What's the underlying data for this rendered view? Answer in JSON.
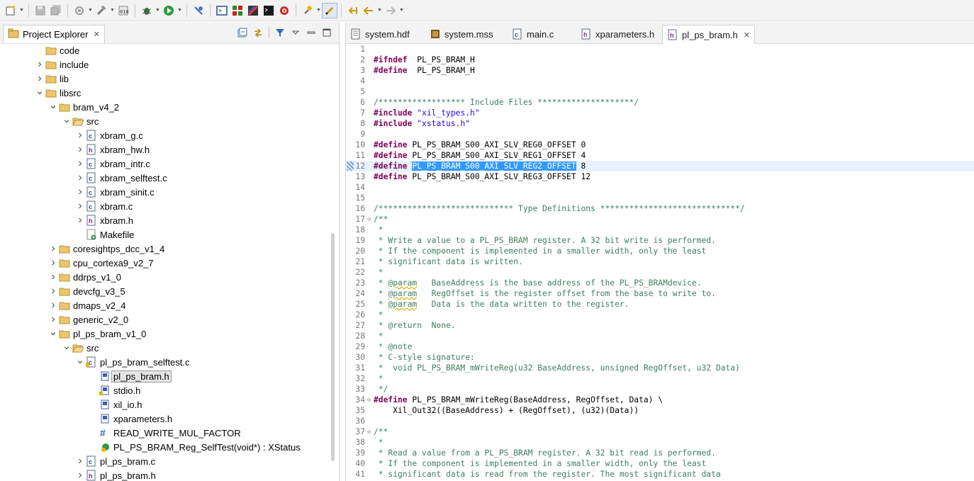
{
  "toolbar": {
    "buttons": [
      "new-icon",
      "save-icon",
      "save-all-icon",
      "preferences-icon",
      "build-icon",
      "program-fpga-icon",
      "debug-icon",
      "run-icon",
      "skip-breakpoints-icon",
      "terminal-icon",
      "xilinx-tools-icon",
      "bitstream-icon",
      "console-icon",
      "target-icon",
      "pin-icon",
      "toggle-mark-occurrences-icon",
      "last-edit-icon",
      "back-icon",
      "forward-icon"
    ]
  },
  "explorer": {
    "title": "Project Explorer",
    "items": [
      {
        "label": "code",
        "depth": 0,
        "arrow": "",
        "icon": "folder"
      },
      {
        "label": "include",
        "depth": 0,
        "arrow": "right",
        "icon": "folder"
      },
      {
        "label": "lib",
        "depth": 0,
        "arrow": "right",
        "icon": "folder"
      },
      {
        "label": "libsrc",
        "depth": 0,
        "arrow": "down",
        "icon": "folder"
      },
      {
        "label": "bram_v4_2",
        "depth": 1,
        "arrow": "down",
        "icon": "folder"
      },
      {
        "label": "src",
        "depth": 2,
        "arrow": "down",
        "icon": "folder-open"
      },
      {
        "label": "xbram_g.c",
        "depth": 3,
        "arrow": "right",
        "icon": "c-file"
      },
      {
        "label": "xbram_hw.h",
        "depth": 3,
        "arrow": "right",
        "icon": "h-file"
      },
      {
        "label": "xbram_intr.c",
        "depth": 3,
        "arrow": "right",
        "icon": "c-file"
      },
      {
        "label": "xbram_selftest.c",
        "depth": 3,
        "arrow": "right",
        "icon": "c-file"
      },
      {
        "label": "xbram_sinit.c",
        "depth": 3,
        "arrow": "right",
        "icon": "c-file"
      },
      {
        "label": "xbram.c",
        "depth": 3,
        "arrow": "right",
        "icon": "c-file"
      },
      {
        "label": "xbram.h",
        "depth": 3,
        "arrow": "right",
        "icon": "h-file"
      },
      {
        "label": "Makefile",
        "depth": 3,
        "arrow": "",
        "icon": "makefile"
      },
      {
        "label": "coresightps_dcc_v1_4",
        "depth": 1,
        "arrow": "right",
        "icon": "folder"
      },
      {
        "label": "cpu_cortexa9_v2_7",
        "depth": 1,
        "arrow": "right",
        "icon": "folder"
      },
      {
        "label": "ddrps_v1_0",
        "depth": 1,
        "arrow": "right",
        "icon": "folder"
      },
      {
        "label": "devcfg_v3_5",
        "depth": 1,
        "arrow": "right",
        "icon": "folder"
      },
      {
        "label": "dmaps_v2_4",
        "depth": 1,
        "arrow": "right",
        "icon": "folder"
      },
      {
        "label": "generic_v2_0",
        "depth": 1,
        "arrow": "right",
        "icon": "folder"
      },
      {
        "label": "pl_ps_bram_v1_0",
        "depth": 1,
        "arrow": "down",
        "icon": "folder"
      },
      {
        "label": "src",
        "depth": 2,
        "arrow": "down",
        "icon": "folder-open"
      },
      {
        "label": "pl_ps_bram_selftest.c",
        "depth": 3,
        "arrow": "down",
        "icon": "c-file-mod"
      },
      {
        "label": "pl_ps_bram.h",
        "depth": 4,
        "arrow": "",
        "icon": "include",
        "selected": true
      },
      {
        "label": "stdio.h",
        "depth": 4,
        "arrow": "",
        "icon": "include-sys"
      },
      {
        "label": "xil_io.h",
        "depth": 4,
        "arrow": "",
        "icon": "include"
      },
      {
        "label": "xparameters.h",
        "depth": 4,
        "arrow": "",
        "icon": "include"
      },
      {
        "label": "READ_WRITE_MUL_FACTOR",
        "depth": 4,
        "arrow": "",
        "icon": "macro"
      },
      {
        "label": "PL_PS_BRAM_Reg_SelfTest(void*) : XStatus",
        "depth": 4,
        "arrow": "",
        "icon": "function"
      },
      {
        "label": "pl_ps_bram.c",
        "depth": 3,
        "arrow": "right",
        "icon": "c-file"
      },
      {
        "label": "pl_ps_bram.h",
        "depth": 3,
        "arrow": "right",
        "icon": "h-file"
      }
    ]
  },
  "editor": {
    "tabs": [
      {
        "label": "system.hdf",
        "icon": "hdf",
        "active": false
      },
      {
        "label": "system.mss",
        "icon": "mss",
        "active": false
      },
      {
        "label": "main.c",
        "icon": "c-file",
        "active": false
      },
      {
        "label": "xparameters.h",
        "icon": "h-file",
        "active": false
      },
      {
        "label": "pl_ps_bram.h",
        "icon": "h-file",
        "active": true
      }
    ],
    "current_line": 12,
    "lines": [
      {
        "n": "1",
        "fold": "",
        "parts": []
      },
      {
        "n": "2",
        "fold": "",
        "parts": [
          [
            "kw",
            "#ifndef"
          ],
          [
            "",
            "  PL_PS_BRAM_H"
          ]
        ]
      },
      {
        "n": "3",
        "fold": "",
        "parts": [
          [
            "kw",
            "#define"
          ],
          [
            "",
            "  PL_PS_BRAM_H"
          ]
        ]
      },
      {
        "n": "4",
        "fold": "",
        "parts": []
      },
      {
        "n": "5",
        "fold": "",
        "parts": []
      },
      {
        "n": "6",
        "fold": "",
        "parts": [
          [
            "cm",
            "/****************** Include Files ********************/"
          ]
        ]
      },
      {
        "n": "7",
        "fold": "",
        "parts": [
          [
            "kw",
            "#include"
          ],
          [
            "",
            " "
          ],
          [
            "str",
            "\"xil_types.h\""
          ]
        ]
      },
      {
        "n": "8",
        "fold": "",
        "parts": [
          [
            "kw",
            "#include"
          ],
          [
            "",
            " "
          ],
          [
            "str",
            "\"xstatus.h\""
          ]
        ]
      },
      {
        "n": "9",
        "fold": "",
        "parts": []
      },
      {
        "n": "10",
        "fold": "",
        "parts": [
          [
            "kw",
            "#define"
          ],
          [
            "",
            " PL_PS_BRAM_S00_AXI_SLV_REG0_OFFSET 0"
          ]
        ]
      },
      {
        "n": "11",
        "fold": "",
        "parts": [
          [
            "kw",
            "#define"
          ],
          [
            "",
            " PL_PS_BRAM_S00_AXI_SLV_REG1_OFFSET 4"
          ]
        ]
      },
      {
        "n": "12",
        "fold": "",
        "parts": [
          [
            "kw",
            "#define"
          ],
          [
            "",
            " "
          ],
          [
            "hl",
            "PL_PS_BRAM_S00_AXI_SLV_REG2_OFFSET"
          ],
          [
            "",
            " 8"
          ]
        ],
        "mark": true
      },
      {
        "n": "13",
        "fold": "",
        "parts": [
          [
            "kw",
            "#define"
          ],
          [
            "",
            " PL_PS_BRAM_S00_AXI_SLV_REG3_OFFSET 12"
          ]
        ]
      },
      {
        "n": "14",
        "fold": "",
        "parts": []
      },
      {
        "n": "15",
        "fold": "",
        "parts": []
      },
      {
        "n": "16",
        "fold": "",
        "parts": [
          [
            "cm",
            "/**************************** Type Definitions *****************************/"
          ]
        ]
      },
      {
        "n": "17",
        "fold": "⊖",
        "parts": [
          [
            "cm",
            "/**"
          ]
        ]
      },
      {
        "n": "18",
        "fold": "",
        "parts": [
          [
            "cm",
            " *"
          ]
        ]
      },
      {
        "n": "19",
        "fold": "",
        "parts": [
          [
            "cm",
            " * Write a value to a PL_PS_BRAM register. A 32 bit write is performed."
          ]
        ]
      },
      {
        "n": "20",
        "fold": "",
        "parts": [
          [
            "cm",
            " * If the component is implemented in a smaller width, only the least"
          ]
        ]
      },
      {
        "n": "21",
        "fold": "",
        "parts": [
          [
            "cm",
            " * significant data is written."
          ]
        ]
      },
      {
        "n": "22",
        "fold": "",
        "parts": [
          [
            "cm",
            " *"
          ]
        ]
      },
      {
        "n": "23",
        "fold": "",
        "parts": [
          [
            "cm",
            " * "
          ],
          [
            "cmsq",
            "@param"
          ],
          [
            "cm",
            "   BaseAddress is the base address of the PL_PS_BRAMdevice."
          ]
        ]
      },
      {
        "n": "24",
        "fold": "",
        "parts": [
          [
            "cm",
            " * "
          ],
          [
            "cmsq",
            "@param"
          ],
          [
            "cm",
            "   RegOffset is the register offset from the base to write to."
          ]
        ]
      },
      {
        "n": "25",
        "fold": "",
        "parts": [
          [
            "cm",
            " * "
          ],
          [
            "cmsq",
            "@param"
          ],
          [
            "cm",
            "   Data is the data written to the register."
          ]
        ]
      },
      {
        "n": "26",
        "fold": "",
        "parts": [
          [
            "cm",
            " *"
          ]
        ]
      },
      {
        "n": "27",
        "fold": "",
        "parts": [
          [
            "cm",
            " * @return  None."
          ]
        ]
      },
      {
        "n": "28",
        "fold": "",
        "parts": [
          [
            "cm",
            " *"
          ]
        ]
      },
      {
        "n": "29",
        "fold": "",
        "parts": [
          [
            "cm",
            " * @note"
          ]
        ]
      },
      {
        "n": "30",
        "fold": "",
        "parts": [
          [
            "cm",
            " * C-style signature:"
          ]
        ]
      },
      {
        "n": "31",
        "fold": "",
        "parts": [
          [
            "cm",
            " *  void PL_PS_BRAM_mWriteReg(u32 BaseAddress, unsigned RegOffset, u32 Data)"
          ]
        ]
      },
      {
        "n": "32",
        "fold": "",
        "parts": [
          [
            "cm",
            " *"
          ]
        ]
      },
      {
        "n": "33",
        "fold": "",
        "parts": [
          [
            "cm",
            " */"
          ]
        ]
      },
      {
        "n": "34",
        "fold": "⊖",
        "parts": [
          [
            "kw",
            "#define"
          ],
          [
            "",
            " PL_PS_BRAM_mWriteReg(BaseAddress, RegOffset, Data) \\"
          ]
        ]
      },
      {
        "n": "35",
        "fold": "",
        "parts": [
          [
            "",
            "    Xil_Out32((BaseAddress) + (RegOffset), (u32)(Data))"
          ]
        ]
      },
      {
        "n": "36",
        "fold": "",
        "parts": []
      },
      {
        "n": "37",
        "fold": "⊖",
        "parts": [
          [
            "cm",
            "/**"
          ]
        ]
      },
      {
        "n": "38",
        "fold": "",
        "parts": [
          [
            "cm",
            " *"
          ]
        ]
      },
      {
        "n": "39",
        "fold": "",
        "parts": [
          [
            "cm",
            " * Read a value from a PL_PS_BRAM register. A 32 bit read is performed."
          ]
        ]
      },
      {
        "n": "40",
        "fold": "",
        "parts": [
          [
            "cm",
            " * If the component is implemented in a smaller width, only the least"
          ]
        ]
      },
      {
        "n": "41",
        "fold": "",
        "parts": [
          [
            "cm",
            " * significant data is read from the register. The most significant data"
          ]
        ]
      }
    ]
  },
  "colors": {
    "keyword": "#7f0055",
    "string": "#2a00ff",
    "comment": "#3f7f5f",
    "selection": "#3399ff",
    "current_line": "#e8f2fe",
    "folder": "#e9c46a"
  }
}
